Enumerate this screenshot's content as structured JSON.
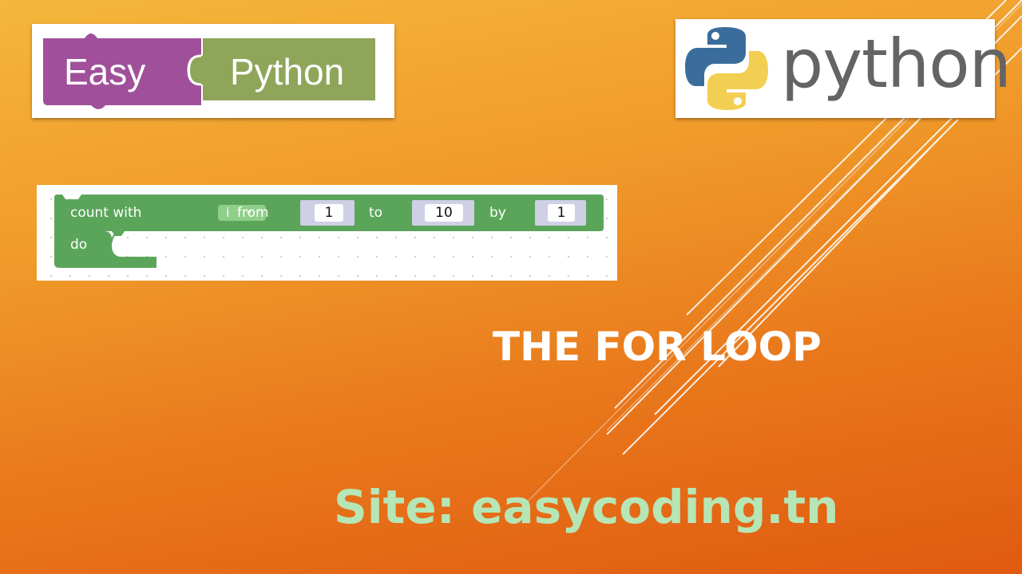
{
  "logo_easy_python": {
    "word1": "Easy",
    "word2": "Python",
    "color1": "#a0509a",
    "color2": "#8fa55a"
  },
  "logo_python": {
    "text": "python",
    "blue": "#3a6d9c",
    "yellow": "#f2cf52"
  },
  "block": {
    "label_count": "count with",
    "variable": "i",
    "dropdown_caret": "▾",
    "label_from": "from",
    "from_value": "1",
    "label_to": "to",
    "to_value": "10",
    "label_by": "by",
    "by_value": "1",
    "label_do": "do",
    "color": "#5ba55b"
  },
  "title": "THE FOR LOOP",
  "site_line": "Site: easycoding.tn"
}
